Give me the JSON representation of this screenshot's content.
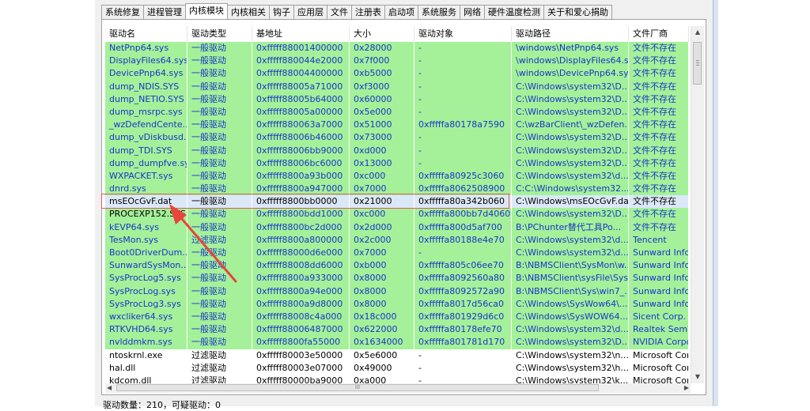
{
  "tabs": [
    "系统修复",
    "进程管理",
    "内核模块",
    "内核相关",
    "钩子",
    "应用层",
    "文件",
    "注册表",
    "启动项",
    "系统服务",
    "网络",
    "硬件温度检测",
    "关于和爱心捐助"
  ],
  "active_tab": 2,
  "columns": [
    "驱动名",
    "驱动类型",
    "基地址",
    "大小",
    "驱动对象",
    "驱动路径",
    "文件厂商"
  ],
  "rows": [
    {
      "style": "g",
      "cells": [
        "NetPnp64.sys",
        "一般驱动",
        "0xfffff88001400000",
        "0x28000",
        "-",
        "\\windows\\NetPnp64.sys",
        "文件不存在"
      ]
    },
    {
      "style": "g",
      "cells": [
        "DisplayFiles64.sys",
        "一般驱动",
        "0xfffff880044e2000",
        "0x7f000",
        "-",
        "\\windows\\DisplayFiles64.sys",
        "文件不存在"
      ]
    },
    {
      "style": "g",
      "cells": [
        "DevicePnp64.sys",
        "一般驱动",
        "0xfffff88004400000",
        "0xb5000",
        "-",
        "\\windows\\DevicePnp64.sys",
        "文件不存在"
      ]
    },
    {
      "style": "g",
      "cells": [
        "dump_NDIS.SYS",
        "一般驱动",
        "0xfffff88005a71000",
        "0xf3000",
        "-",
        "C:\\Windows\\system32\\D...",
        "文件不存在"
      ]
    },
    {
      "style": "g",
      "cells": [
        "dump_NETIO.SYS",
        "一般驱动",
        "0xfffff88005b64000",
        "0x60000",
        "-",
        "C:\\Windows\\system32\\D...",
        "文件不存在"
      ]
    },
    {
      "style": "g",
      "cells": [
        "dump_msrpc.sys",
        "一般驱动",
        "0xfffff88005a00000",
        "0x5e000",
        "-",
        "C:\\Windows\\system32\\D...",
        "文件不存在"
      ]
    },
    {
      "style": "g",
      "cells": [
        "_wzDefendCente...",
        "一般驱动",
        "0xfffff880063a7000",
        "0x51000",
        "0xfffffa80178a7590",
        "C:\\wzBarClient\\_wzDefen...",
        "文件不存在"
      ]
    },
    {
      "style": "g",
      "cells": [
        "dump_vDiskbusd...",
        "一般驱动",
        "0xfffff88006b46000",
        "0x73000",
        "-",
        "C:\\Windows\\system32\\D...",
        "文件不存在"
      ]
    },
    {
      "style": "g",
      "cells": [
        "dump_TDI.SYS",
        "一般驱动",
        "0xfffff88006bb9000",
        "0xd000",
        "-",
        "C:\\Windows\\system32\\D...",
        "文件不存在"
      ]
    },
    {
      "style": "g",
      "cells": [
        "dump_dumpfve.sys",
        "一般驱动",
        "0xfffff88006bc6000",
        "0x13000",
        "-",
        "C:\\Windows\\system32\\D...",
        "文件不存在"
      ]
    },
    {
      "style": "g",
      "cells": [
        "WXPACKET.sys",
        "一般驱动",
        "0xfffff8800a93b000",
        "0xc000",
        "0xfffffa80925c3060",
        "C:\\Windows\\system32\\d...",
        "文件不存在"
      ]
    },
    {
      "style": "g",
      "cells": [
        "dnrd.sys",
        "一般驱动",
        "0xfffff8800a947000",
        "0x7000",
        "0xfffffa8062508900",
        "C:C:\\Windows\\system32...",
        "文件不存在"
      ]
    },
    {
      "style": "s",
      "cells": [
        "msEOcGvF.dat",
        "一般驱动",
        "0xfffff8800bb0000",
        "0x21000",
        "0xfffffa80a342b060",
        "C:\\Windows\\msEOcGvF.dat",
        "文件不存在"
      ]
    },
    {
      "style": "g",
      "cells": [
        "PROCEXP152.SYS",
        "一般驱动",
        "0xfffff8800bdd1000",
        "0xc000",
        "0xfffffa800bb7d4060",
        "C:\\Windows\\system32\\D...",
        "文件不存在"
      ],
      "black0": true
    },
    {
      "style": "g",
      "cells": [
        "kEVP64.sys",
        "一般驱动",
        "0xfffff8800bc2d000",
        "0x2d000",
        "0xfffffa800d5af700",
        "B:\\PChunter替代工具Po...",
        "文件不存在"
      ]
    },
    {
      "style": "g",
      "cells": [
        "TesMon.sys",
        "过滤驱动",
        "0xfffff8800a800000",
        "0x2c000",
        "0xfffffa80188e4e70",
        "C:\\Windows\\system32\\d...",
        "Tencent"
      ]
    },
    {
      "style": "g",
      "cells": [
        "Boot0DriverDum...",
        "一般驱动",
        "0xfffff88000d6e000",
        "0x7000",
        "-",
        "C:\\Windows\\system32\\d...",
        "Sunward Inform"
      ]
    },
    {
      "style": "g",
      "cells": [
        "SunwardSysMon....",
        "一般驱动",
        "0xfffff88008dd6000",
        "0xb000",
        "0xfffffa805c06ee70",
        "B:\\NBMSClient\\SysMon\\w...",
        "Sunward Inform"
      ]
    },
    {
      "style": "g",
      "cells": [
        "SysProcLog5.sys",
        "一般驱动",
        "0xfffff8800a933000",
        "0x8000",
        "0xfffffa8092560a80",
        "B:\\NBMSClient\\sysFile\\Sys...",
        "Sunward Inform"
      ]
    },
    {
      "style": "g",
      "cells": [
        "SysProcLog.sys",
        "一般驱动",
        "0xfffff8800a94e000",
        "0x8000",
        "0xfffffa8092572a90",
        "B:\\NBMSClient\\Sys\\win7_...",
        "Sunward Inform"
      ]
    },
    {
      "style": "g",
      "cells": [
        "SysProcLog3.sys",
        "一般驱动",
        "0xfffff8800a9d8000",
        "0x8000",
        "0xfffffa8017d56ca0",
        "C:\\Windows\\SysWow64\\...",
        "Sunward Inform"
      ]
    },
    {
      "style": "g",
      "cells": [
        "wxcliker64.sys",
        "一般驱动",
        "0xfffff88008c4a000",
        "0x18c000",
        "0xfffffa801929d6c0",
        "C:\\Windows\\SysWOW64...",
        "Sicent Corp."
      ]
    },
    {
      "style": "g",
      "cells": [
        "RTKVHD64.sys",
        "一般驱动",
        "0xfffff88006487000",
        "0x622000",
        "0xfffffa80178efe70",
        "C:\\Windows\\system32\\d...",
        "Realtek Semico"
      ]
    },
    {
      "style": "g",
      "cells": [
        "nvlddmkm.sys",
        "一般驱动",
        "0xfffff8800fa55000",
        "0x1634000",
        "0xfffffa801781d170",
        "C:\\Windows\\system32\\D...",
        "NVIDIA Corpora"
      ]
    },
    {
      "style": "w",
      "cells": [
        "ntoskrnl.exe",
        "过滤驱动",
        "0xfffff80003e50000",
        "0x5e6000",
        "-",
        "C:\\Windows\\system32\\n...",
        "Microsoft Corpo"
      ]
    },
    {
      "style": "w",
      "cells": [
        "hal.dll",
        "过滤驱动",
        "0xfffff80003e07000",
        "0x49000",
        "-",
        "C:\\Windows\\system32\\h...",
        "Microsoft Corpo"
      ]
    },
    {
      "style": "w",
      "cells": [
        "kdcom.dll",
        "过滤驱动",
        "0xfffff80000ba9000",
        "0xa000",
        "-",
        "C:\\Windows\\system32\\k...",
        "Microsoft Corpo"
      ]
    }
  ],
  "status_text": "驱动数量：210，可疑驱动：0",
  "hscroll_grip": "III",
  "scroll_up_icon": "up-arrow",
  "scroll_down_icon": "down-arrow"
}
